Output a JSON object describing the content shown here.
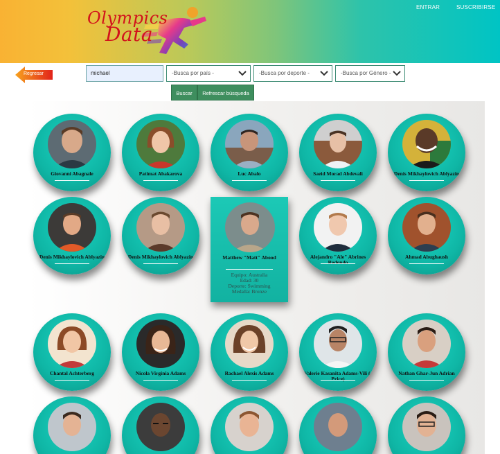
{
  "header": {
    "logo_line1": "Olympics",
    "logo_line2": "Data",
    "nav": {
      "entrar": "ENTRAR",
      "suscribirse": "SUSCRIBIRSE"
    }
  },
  "toolbar": {
    "back_label": "Regresar",
    "search_value": "michael",
    "country_select": "-Busca por país -",
    "sport_select": "-Busca por deporte -",
    "gender_select": "-Busca por Género -",
    "search_button": "Buscar",
    "refresh_button": "Refrescar búsqueda"
  },
  "athletes": [
    {
      "name": "Giovanni Abagnale"
    },
    {
      "name": "Patimat Abakarova"
    },
    {
      "name": "Luc Abalo"
    },
    {
      "name": "Saeid Morad Abdevali"
    },
    {
      "name": "Denis Mikhaylovich Ablyazin"
    },
    {
      "name": "Denis Mikhaylovich Ablyazin"
    },
    {
      "name": "Denis Mikhaylovich Ablyazin"
    },
    {
      "name": "Matthew \"Matt\" Abood"
    },
    {
      "name": "Alejandro \"Ale\" Abrines Redondo"
    },
    {
      "name": "Ahmad Abughaush"
    },
    {
      "name": "Chantal Achterberg"
    },
    {
      "name": "Nicola Virginia Adams"
    },
    {
      "name": "Rachael Alexis Adams"
    },
    {
      "name": "Valerie Kasanita Adams-Vili (-Price)"
    },
    {
      "name": "Nathan Ghar-Jun Adrian"
    }
  ],
  "expanded_details": {
    "equipo": "Equipo: Australia",
    "edad": "Edad: 30",
    "deporte": "Deporte: Swimming",
    "medalla": "Medalla: Bronze"
  },
  "colors": {
    "card_teal": "#12b2a1",
    "button_green": "#3e8e5e",
    "logo_red": "#d2121c",
    "back_orange": "#f28c1e"
  }
}
